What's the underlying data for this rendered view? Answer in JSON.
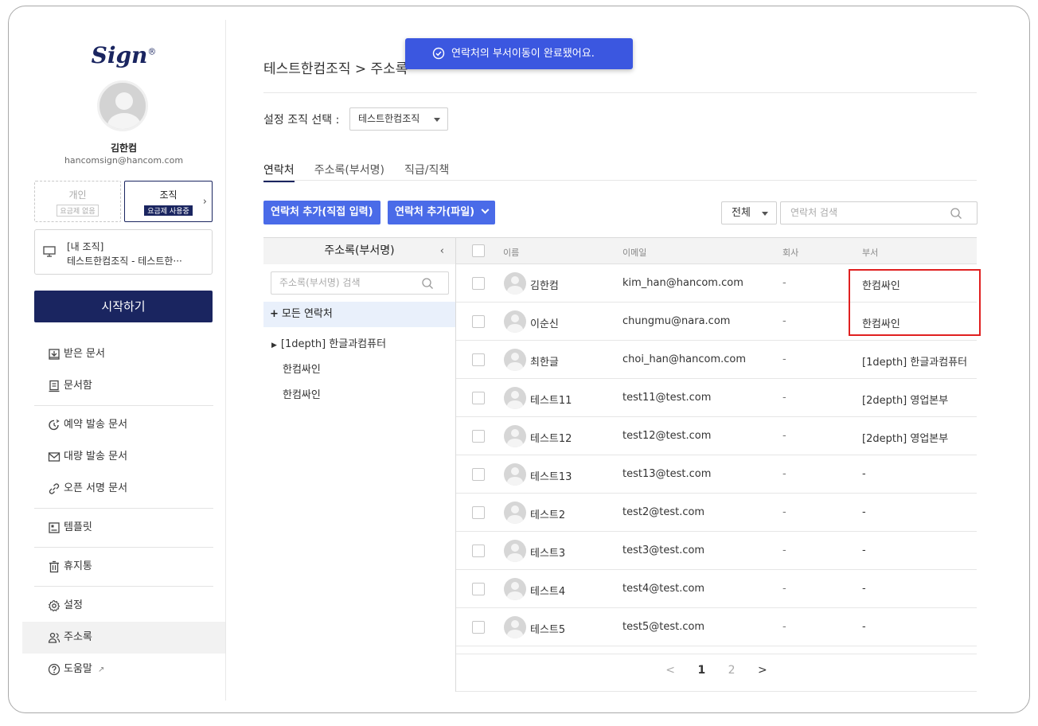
{
  "brand": {
    "logo": "Sign",
    "mark": "®"
  },
  "user": {
    "name": "김한컴",
    "email": "hancomsign@hancom.com"
  },
  "plans": {
    "personal": {
      "label": "개인",
      "tag": "요금제 없음"
    },
    "org": {
      "label": "조직",
      "tag": "요금제 사용중"
    }
  },
  "my_org": {
    "title": "[내 조직]",
    "value": "테스트한컴조직 - 테스트한···"
  },
  "start_button": "시작하기",
  "menu": [
    {
      "label": "받은 문서",
      "icon": "inbox-icon"
    },
    {
      "label": "문서함",
      "icon": "document-box-icon"
    },
    {
      "label": "예약 발송 문서",
      "icon": "schedule-icon"
    },
    {
      "label": "대량 발송 문서",
      "icon": "mail-icon"
    },
    {
      "label": "오픈 서명 문서",
      "icon": "link-icon"
    },
    {
      "label": "템플릿",
      "icon": "template-icon"
    },
    {
      "label": "휴지통",
      "icon": "trash-icon"
    },
    {
      "label": "설정",
      "icon": "gear-icon"
    },
    {
      "label": "주소록",
      "icon": "contacts-icon",
      "active": true
    },
    {
      "label": "도움말",
      "icon": "help-icon"
    }
  ],
  "toast": "연락처의 부서이동이 완료됐어요.",
  "breadcrumb": "테스트한컴조직 > 주소록",
  "org_select": {
    "label": "설정 조직 선택 :",
    "value": "테스트한컴조직"
  },
  "tabs": [
    "연락처",
    "주소록(부서명)",
    "직급/직책"
  ],
  "buttons": {
    "add_direct": "연락처 추가(직접 입력)",
    "add_file": "연락처 추가(파일)"
  },
  "filter": {
    "value": "전체"
  },
  "search": {
    "placeholder": "연락처 검색"
  },
  "left_panel": {
    "title": "주소록(부서명)",
    "search_placeholder": "주소록(부서명) 검색",
    "all": "모든 연락처",
    "tree": [
      "[1depth] 한글과컴퓨터",
      "한컴싸인",
      "한컴싸인"
    ]
  },
  "table": {
    "headers": [
      "이름",
      "이메일",
      "회사",
      "부서"
    ],
    "rows": [
      {
        "name": "김한컴",
        "email": "kim_han@hancom.com",
        "company": "-",
        "dept": "한컴싸인"
      },
      {
        "name": "이순신",
        "email": "chungmu@nara.com",
        "company": "-",
        "dept": "한컴싸인"
      },
      {
        "name": "최한글",
        "email": "choi_han@hancom.com",
        "company": "-",
        "dept": "[1depth] 한글과컴퓨터"
      },
      {
        "name": "테스트11",
        "email": "test11@test.com",
        "company": "-",
        "dept": "[2depth] 영업본부"
      },
      {
        "name": "테스트12",
        "email": "test12@test.com",
        "company": "-",
        "dept": "[2depth] 영업본부"
      },
      {
        "name": "테스트13",
        "email": "test13@test.com",
        "company": "-",
        "dept": "-"
      },
      {
        "name": "테스트2",
        "email": "test2@test.com",
        "company": "-",
        "dept": "-"
      },
      {
        "name": "테스트3",
        "email": "test3@test.com",
        "company": "-",
        "dept": "-"
      },
      {
        "name": "테스트4",
        "email": "test4@test.com",
        "company": "-",
        "dept": "-"
      },
      {
        "name": "테스트5",
        "email": "test5@test.com",
        "company": "-",
        "dept": "-"
      }
    ]
  },
  "pagination": {
    "pages": [
      "1",
      "2"
    ],
    "current": "1",
    "prev": "<",
    "next": ">"
  },
  "colors": {
    "navy": "#1a2560",
    "blue": "#4a6be8",
    "toast": "#3b57e0",
    "highlight": "#e02020"
  }
}
